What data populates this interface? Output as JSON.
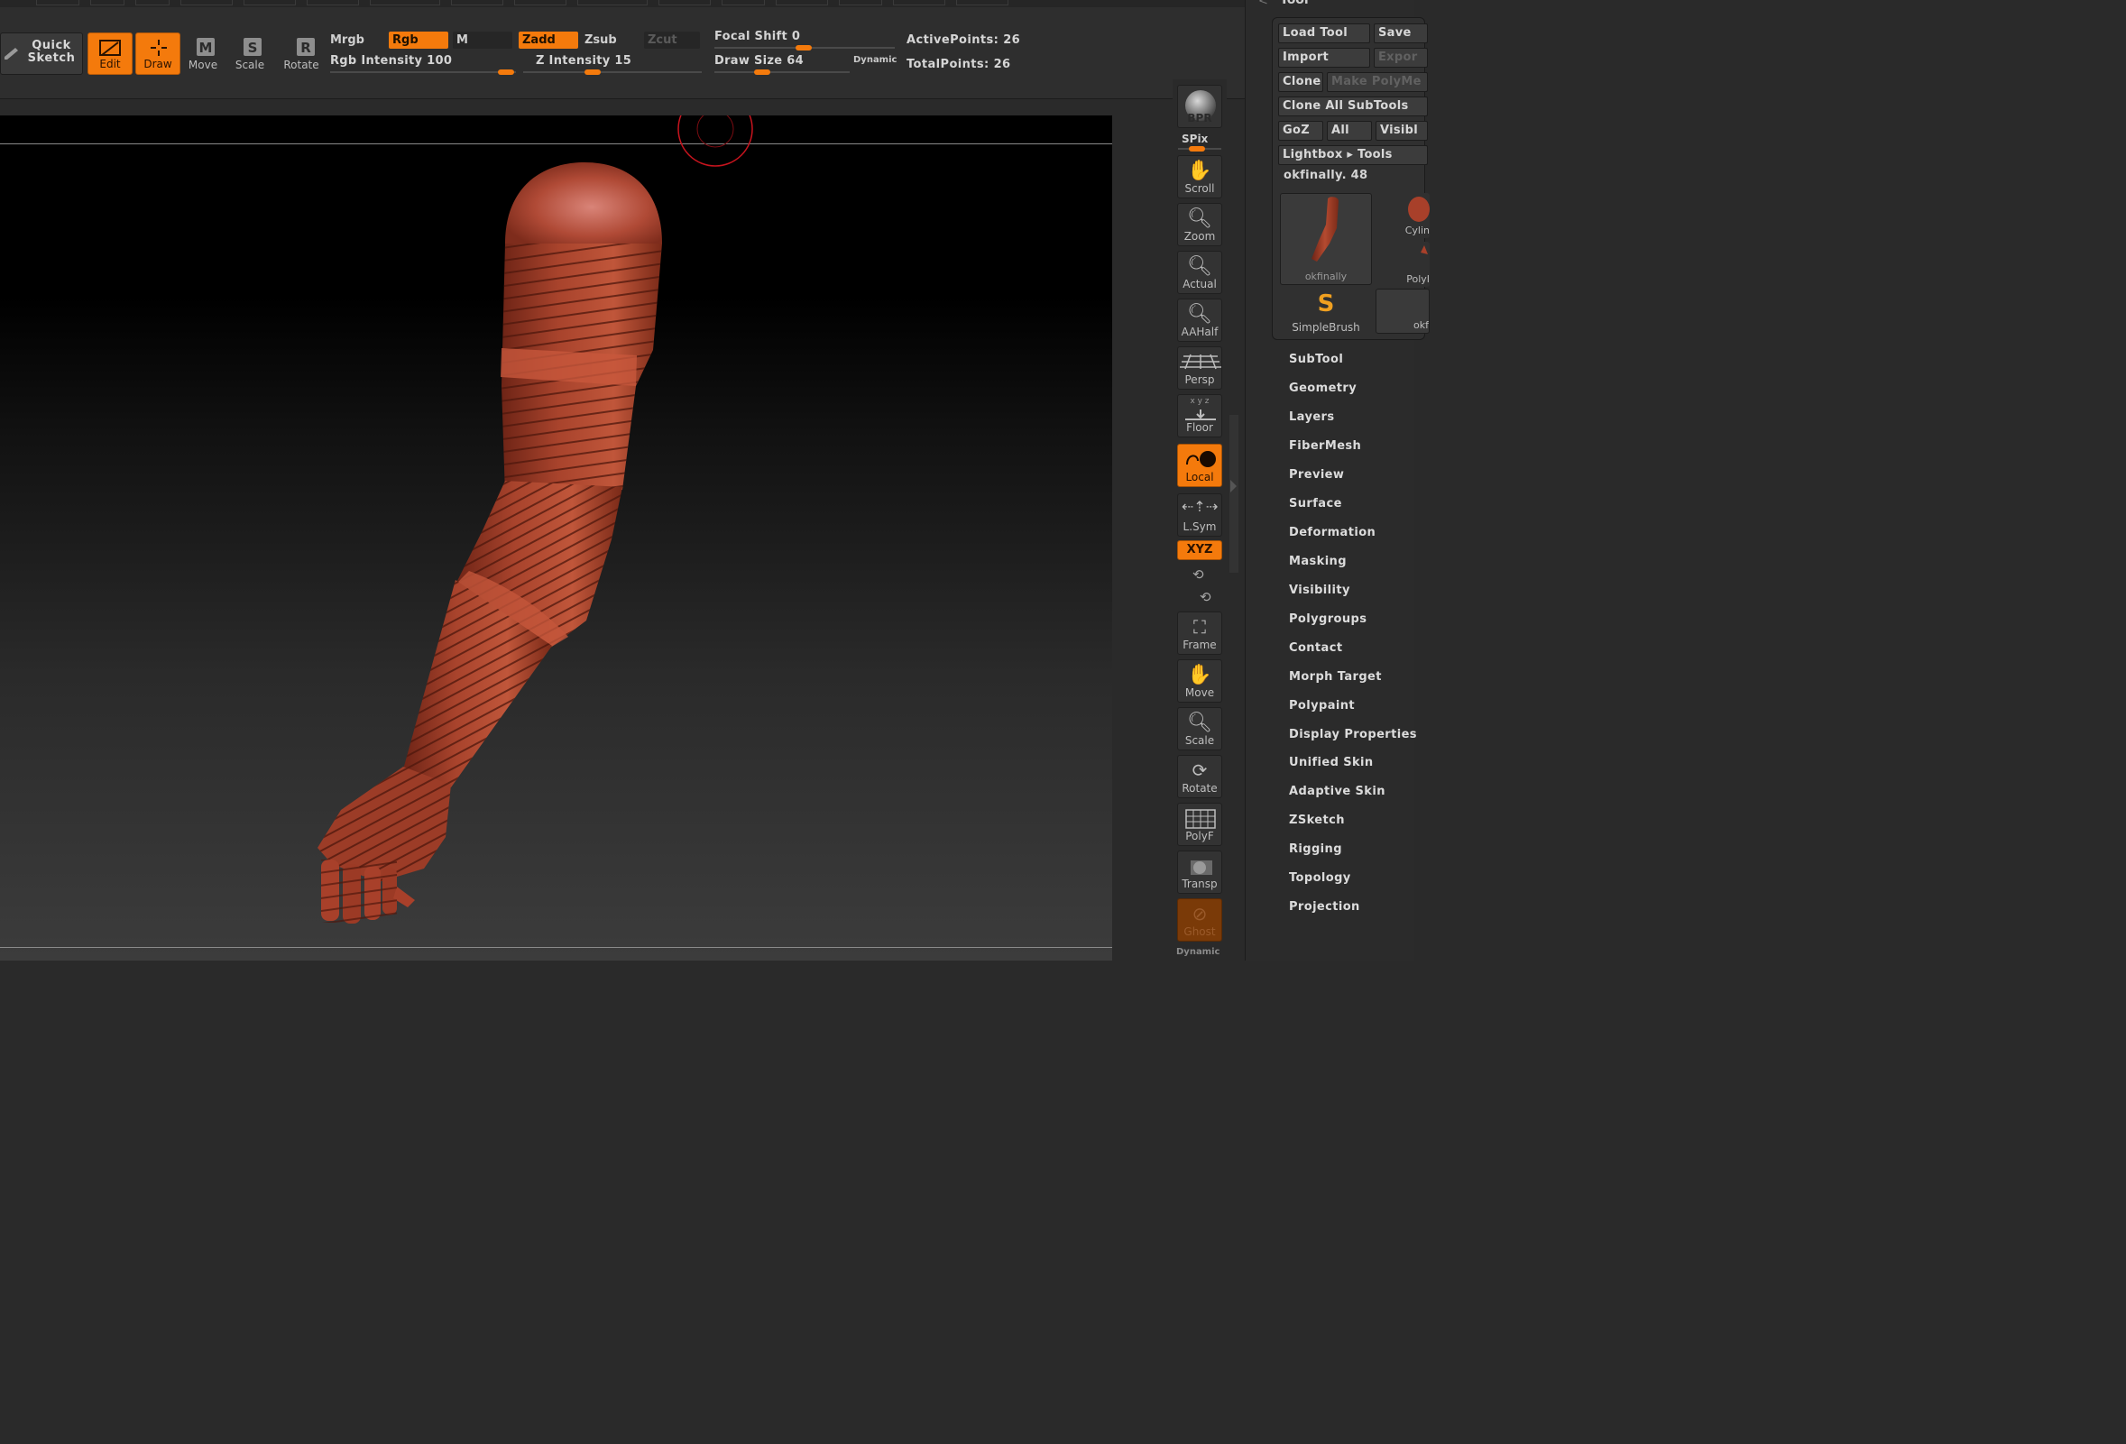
{
  "top": {
    "quick_sketch": "Quick Sketch",
    "modes": {
      "edit": "Edit",
      "draw": "Draw",
      "move": "Move",
      "scale": "Scale",
      "rotate": "Rotate"
    },
    "mode_glyphs": {
      "move": "M",
      "scale": "S",
      "rotate": "R"
    },
    "color": {
      "mrgb": "Mrgb",
      "rgb": "Rgb",
      "m": "M"
    },
    "rgb_intensity_label": "Rgb Intensity",
    "rgb_intensity": "100",
    "depth": {
      "zadd": "Zadd",
      "zsub": "Zsub",
      "zcut": "Zcut"
    },
    "z_intensity_label": "Z Intensity",
    "z_intensity": "15",
    "focal_shift_label": "Focal Shift",
    "focal_shift": "0",
    "draw_size_label": "Draw Size",
    "draw_size": "64",
    "dynamic": "Dynamic",
    "active_points_label": "ActivePoints:",
    "active_points": "26",
    "total_points_label": "TotalPoints:",
    "total_points": "26"
  },
  "rstrip": {
    "bpr": "BPR",
    "spix": "SPix",
    "scroll": "Scroll",
    "zoom": "Zoom",
    "actual": "Actual",
    "aahalf": "AAHalf",
    "persp": "Persp",
    "floor": "Floor",
    "floor_axes": "x y z",
    "local": "Local",
    "lsym": "L.Sym",
    "xyz": "XYZ",
    "frame": "Frame",
    "move": "Move",
    "scale": "Scale",
    "rotate": "Rotate",
    "polyf": "PolyF",
    "transp": "Transp",
    "ghost": "Ghost",
    "dynamic": "Dynamic"
  },
  "palette": {
    "title": "Tool",
    "load_tool": "Load Tool",
    "save": "Save",
    "import": "Import",
    "export": "Expor",
    "clone": "Clone",
    "make_polymesh": "Make PolyMe",
    "clone_all": "Clone All SubTools",
    "goz": "GoZ",
    "all": "All",
    "visible": "Visibl",
    "lightbox_tools": "Lightbox ▸ Tools",
    "current_tool": "okfinally. 48",
    "thumbs": {
      "okfinally": "okfinally",
      "cylinder": "Cylin",
      "poly": "PolyI",
      "simplebrush": "SimpleBrush",
      "okf": "okf"
    },
    "menu": [
      "SubTool",
      "Geometry",
      "Layers",
      "FiberMesh",
      "Preview",
      "Surface",
      "Deformation",
      "Masking",
      "Visibility",
      "Polygroups",
      "Contact",
      "Morph Target",
      "Polypaint",
      "Display Properties",
      "Unified Skin",
      "Adaptive Skin",
      "ZSketch",
      "Rigging",
      "Topology",
      "Projection"
    ]
  },
  "colors": {
    "accent": "#f47a0c",
    "clay": "#a8432c"
  }
}
